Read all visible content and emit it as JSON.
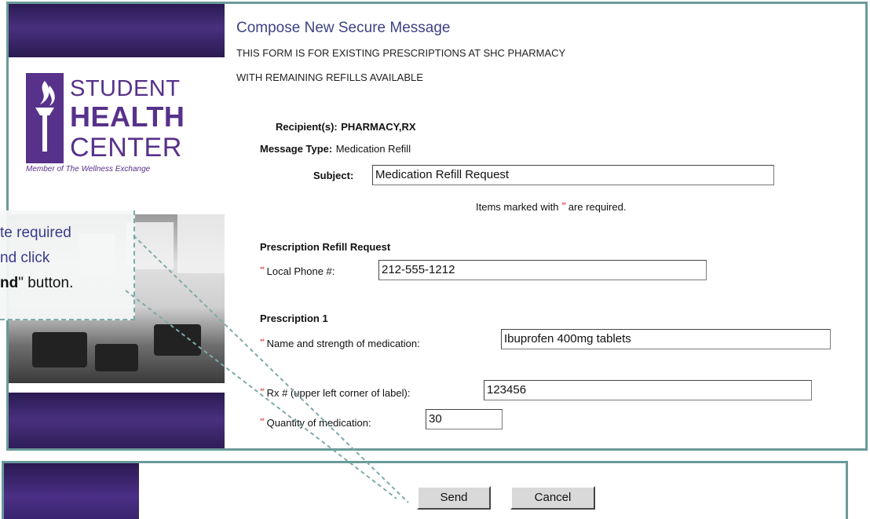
{
  "form": {
    "title": "Compose New Secure Message",
    "subtitle_line1": "THIS FORM IS FOR EXISTING PRESCRIPTIONS AT SHC PHARMACY",
    "subtitle_line2": "WITH REMAINING REFILLS AVAILABLE",
    "recipient_label": "Recipient(s):",
    "recipient_value": "PHARMACY,RX",
    "message_type_label": "Message Type:",
    "message_type_value": "Medication Refill",
    "subject_label": "Subject:",
    "subject_value": "Medication Refill Request",
    "required_note_prefix": "Items marked with",
    "required_note_suffix": "are required.",
    "required_marker": "**",
    "refill_section_title": "Prescription Refill Request",
    "phone_label": "Local Phone #:",
    "phone_value": "212-555-1212",
    "prescription_title": "Prescription 1",
    "med_name_label": "Name and strength of medication:",
    "med_name_value": "Ibuprofen 400mg tablets",
    "rx_label": "Rx # (upper left corner of label):",
    "rx_value": "123456",
    "quantity_label": "Quantity of medication:",
    "quantity_value": "30"
  },
  "logo": {
    "line1": "STUDENT",
    "line2": "HEALTH",
    "line3": "CENTER",
    "tagline": "Member of The Wellness Exchange"
  },
  "callout": {
    "line1": "te required",
    "line2": "nd click",
    "line3_bold": "nd",
    "line3_rest": "\" button."
  },
  "buttons": {
    "send": "Send",
    "cancel": "Cancel"
  },
  "colors": {
    "brand_purple": "#57318a",
    "frame_teal": "#6a9a9a",
    "title_blue": "#3b4383",
    "required_red": "#d92b2b"
  }
}
